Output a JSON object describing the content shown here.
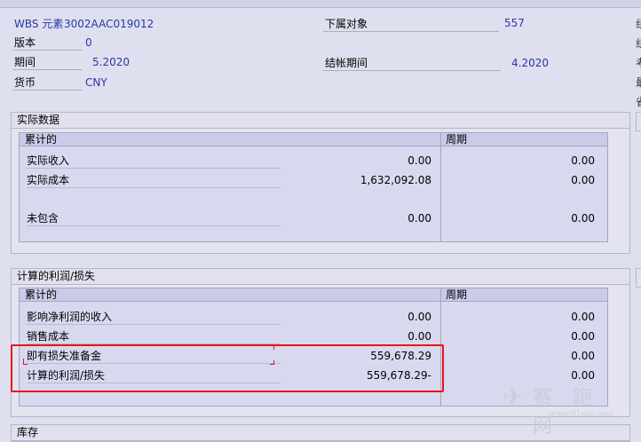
{
  "header": {
    "wbs_label": "WBS 元素",
    "wbs_value": "3002AAC019012",
    "version_label": "版本",
    "version_value": "0",
    "period_label": "期间",
    "period_value": "5.2020",
    "currency_label": "货币",
    "currency_value": "CNY",
    "sub_object_label": "下属对象",
    "sub_object_value": "557",
    "closing_period_label": "结帐期间",
    "closing_period_value": "4.2020"
  },
  "actual": {
    "title": "实际数据",
    "col_cumulative": "累计的",
    "col_period": "周期",
    "rows": [
      {
        "label": "实际收入",
        "cumulative": "0.00",
        "period": "0.00"
      },
      {
        "label": "实际成本",
        "cumulative": "1,632,092.08",
        "period": "0.00"
      },
      {
        "label": "未包含",
        "cumulative": "0.00",
        "period": "0.00"
      }
    ]
  },
  "profit": {
    "title": "计算的利润/损失",
    "col_cumulative": "累计的",
    "col_period": "周期",
    "rows": [
      {
        "label": "影响净利润的收入",
        "cumulative": "0.00",
        "period": "0.00"
      },
      {
        "label": "销售成本",
        "cumulative": "0.00",
        "period": "0.00"
      },
      {
        "label": "即有损失准备金",
        "cumulative": "559,678.29",
        "period": "0.00"
      },
      {
        "label": "计算的利润/损失",
        "cumulative": "559,678.29-",
        "period": "0.00"
      }
    ]
  },
  "inventory": {
    "title": "库存"
  },
  "right_edge_chars": [
    "组",
    "组",
    "考",
    "最",
    "省"
  ],
  "watermark": {
    "main": "赛 跑 网",
    "sub": "www.91sap.com"
  },
  "colors": {
    "highlight": "#e8161a",
    "value_blue": "#2a36a8",
    "background": "#dfe0ef"
  }
}
